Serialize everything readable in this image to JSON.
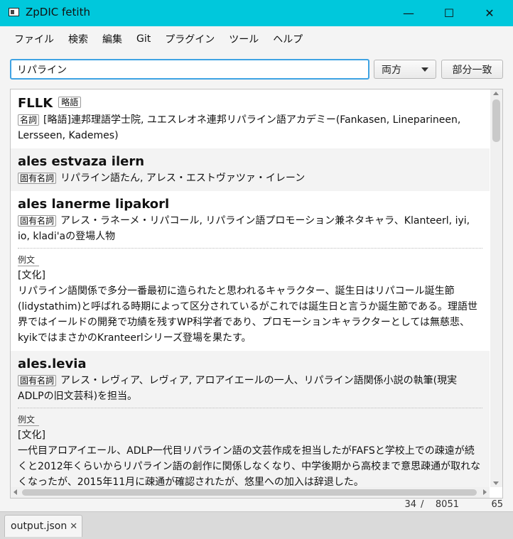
{
  "window": {
    "title": "ZpDIC fetith",
    "minimize": "—",
    "maximize": "☐",
    "close": "✕"
  },
  "menu": [
    "ファイル",
    "検索",
    "編集",
    "Git",
    "プラグイン",
    "ツール",
    "ヘルプ"
  ],
  "search": {
    "value": "リパライン",
    "mode": "両方",
    "match": "部分一致"
  },
  "entries": [
    {
      "headword": "FLLK",
      "tag": "略語",
      "pos": "名詞",
      "meaning": "[略語]連邦理語学士院, ユエスレオネ連邦リパライン語アカデミー(Fankasen, Lineparineen, Lersseen, Kademes)"
    },
    {
      "headword": "ales estvaza ilern",
      "pos": "固有名詞",
      "meaning": "リパライン語たん, アレス・エストヴァツァ・イレーン"
    },
    {
      "headword": "ales lanerme lipakorl",
      "pos": "固有名詞",
      "meaning": "アレス・ラネーメ・リパコール, リパライン語プロモーション兼ネタキャラ、Klanteerl, iyi, io, kladi'aの登場人物",
      "example_label": "例文",
      "example": "[文化]\nリパライン語関係で多分一番最初に造られたと思われるキャラクター、誕生日はリパコール誕生節(lidystathim)と呼ばれる時期によって区分されているがこれでは誕生日と言うか誕生節である。理語世界ではイールドの開発で功績を残すWP科学者であり、プロモーションキャラクターとしては無慈悲、kyikではまさかのKranteerlシリーズ登場を果たす。"
    },
    {
      "headword": "ales.levia",
      "pos": "固有名詞",
      "meaning": "アレス・レヴィア、レヴィア, アロアイエールの一人、リパライン語関係小説の執筆(現実ADLPの旧文芸科)を担当。",
      "example_label": "例文",
      "example": "[文化]\n一代目アロアイエール、ADLP一代目リパライン語の文芸作成を担当したがFAFSと学校上での疎遠が続くと2012年くらいからリパライン語の創作に関係しなくなり、中学後期から高校まで意思疎通が取れなくなったが、2015年11月に疎通が確認されたが、悠里への加入は辞退した。"
    }
  ],
  "status": {
    "current": "34",
    "slash": "/",
    "total": "8051",
    "right": "65"
  },
  "tab": {
    "label": "output.json",
    "close": "✕"
  }
}
